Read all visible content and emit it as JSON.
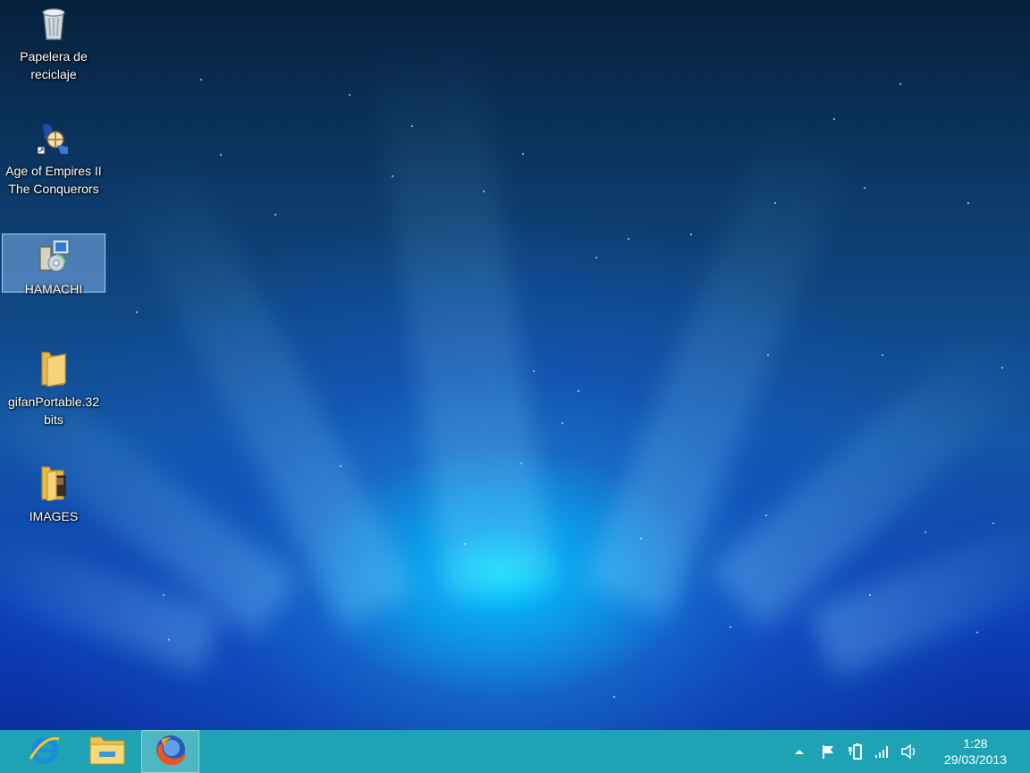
{
  "desktop": {
    "icons": [
      {
        "label": "Papelera de reciclaje",
        "icon": "recycle-bin-icon"
      },
      {
        "label": "Age of Empires II The Conquerors",
        "icon": "age-of-empires-icon"
      },
      {
        "label": "HAMACHI",
        "icon": "installer-icon",
        "selected": true
      },
      {
        "label": "gifanPortable.32 bits",
        "icon": "folder-icon"
      },
      {
        "label": "IMAGES",
        "icon": "folder-icon"
      }
    ]
  },
  "taskbar": {
    "pinned": [
      {
        "name": "Internet Explorer",
        "icon": "internet-explorer-icon"
      },
      {
        "name": "File Explorer",
        "icon": "file-explorer-icon"
      },
      {
        "name": "Firefox",
        "icon": "firefox-icon",
        "active": true
      }
    ],
    "tray": {
      "icons": [
        "show-hidden-icons-icon",
        "action-center-flag-icon",
        "power-icon",
        "network-signal-icon",
        "volume-icon"
      ]
    },
    "clock": {
      "time": "1:28",
      "date": "29/03/2013"
    }
  },
  "colors": {
    "taskbar": "#1ea3b4",
    "selection": "#96c8ff"
  }
}
